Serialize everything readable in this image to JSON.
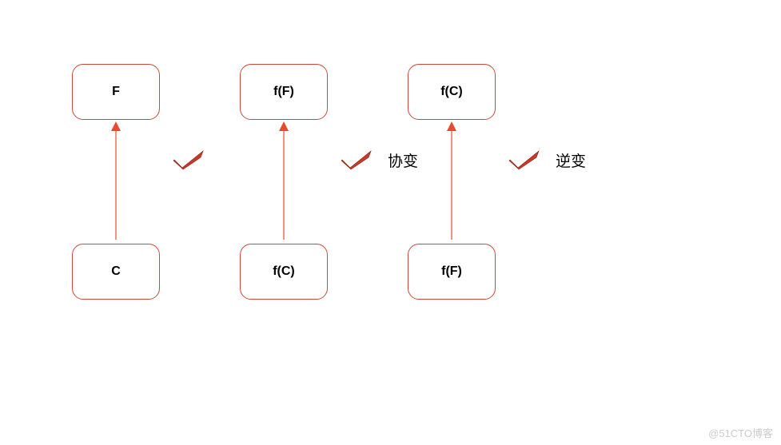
{
  "columns": [
    {
      "top": "F",
      "bottom": "C",
      "label": ""
    },
    {
      "top": "f(F)",
      "bottom": "f(C)",
      "label": "协变"
    },
    {
      "top": "f(C)",
      "bottom": "f(F)",
      "label": "逆变"
    }
  ],
  "watermark": "@51CTO博客",
  "colors": {
    "box_border": "#c94a3a",
    "arrow": "#e84b2c",
    "check_fill": "#c73a2a",
    "check_stroke": "#8a1f14"
  }
}
